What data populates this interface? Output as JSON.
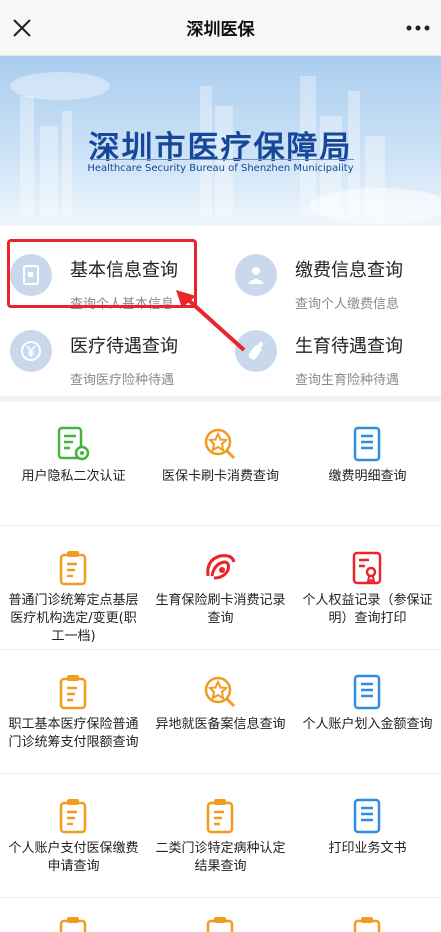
{
  "navbar": {
    "title": "深圳医保"
  },
  "banner": {
    "title": "深圳市医疗保障局",
    "subtitle": "Healthcare Security Bureau of Shenzhen Municipality"
  },
  "quick": [
    {
      "title": "基本信息查询",
      "subtitle": "查询个人基本信息",
      "icon": "id-card-icon"
    },
    {
      "title": "缴费信息查询",
      "subtitle": "查询个人缴费信息",
      "icon": "person-icon"
    },
    {
      "title": "医疗待遇查询",
      "subtitle": "查询医疗险种待遇",
      "icon": "yen-icon"
    },
    {
      "title": "生育待遇查询",
      "subtitle": "查询生育险种待遇",
      "icon": "bottle-icon"
    }
  ],
  "grid": [
    {
      "label": "用户隐私二次认证",
      "icon": "doc-gear-icon"
    },
    {
      "label": "医保卡刷卡消费查询",
      "icon": "badge-search-icon"
    },
    {
      "label": "缴费明细查询",
      "icon": "list-doc-icon"
    },
    {
      "label": "普通门诊统筹定点基层医疗机构选定/变更(职工一档)",
      "icon": "clipboard-icon"
    },
    {
      "label": "生育保险刷卡消费记录查询",
      "icon": "brand-logo-icon"
    },
    {
      "label": "个人权益记录（参保证明）查询打印",
      "icon": "certificate-icon"
    },
    {
      "label": "职工基本医疗保险普通门诊统筹支付限额查询",
      "icon": "clipboard-icon"
    },
    {
      "label": "异地就医备案信息查询",
      "icon": "badge-search-icon"
    },
    {
      "label": "个人账户划入金额查询",
      "icon": "list-doc-icon"
    },
    {
      "label": "个人账户支付医保缴费申请查询",
      "icon": "clipboard-icon"
    },
    {
      "label": "二类门诊特定病种认定结果查询",
      "icon": "clipboard-icon"
    },
    {
      "label": "打印业务文书",
      "icon": "list-doc-icon"
    }
  ],
  "colors": {
    "accent": "#f29b1e",
    "blue": "#2f8de4",
    "green": "#46b33c",
    "red": "#e8252a",
    "title_blue": "#16479a"
  }
}
